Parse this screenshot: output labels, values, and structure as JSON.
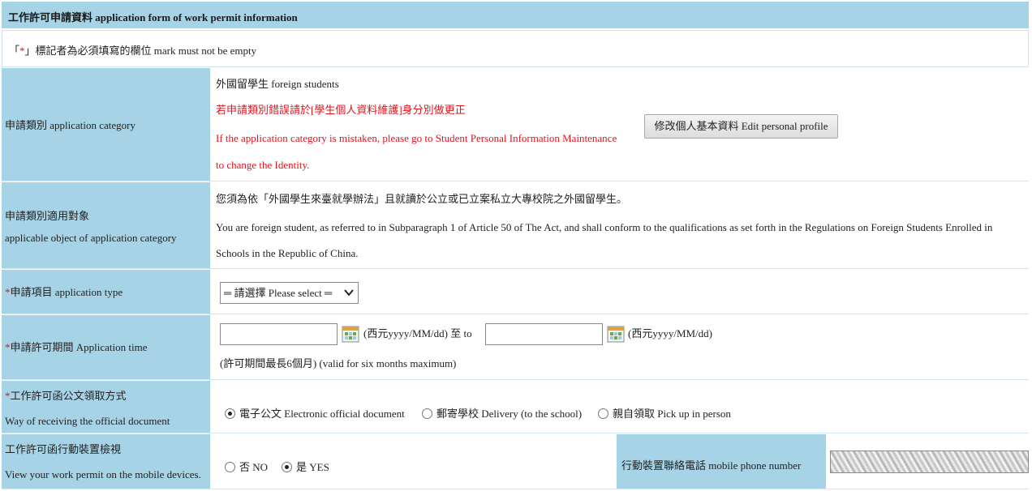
{
  "form": {
    "title": "工作許可申請資料 application form of work permit information",
    "required_note_prefix": "「",
    "required_mark": "*",
    "required_note_suffix": "」標記者為必須填寫的欄位 mark must not be empty",
    "category": {
      "label": "申請類別 application category",
      "value": "外國留學生 foreign students",
      "warning_zh": "若申請類別錯誤請於[學生個人資料維護]身分別做更正",
      "warning_en_1": "If the application category is mistaken, please go to Student Personal Information Maintenance",
      "warning_en_2": "to change the Identity.",
      "edit_button": "修改個人基本資料 Edit personal profile"
    },
    "applicable": {
      "label_zh": "申請類別適用對象",
      "label_en": "applicable object of application category",
      "text_zh": "您須為依「外國學生來臺就學辦法」且就讀於公立或已立案私立大專校院之外國留學生。",
      "text_en_1": "You are foreign student, as referred to in Subparagraph 1 of Article 50 of The Act, and shall conform to the qualifications as set forth in the Regulations on Foreign Students Enrolled in",
      "text_en_2": "Schools in the Republic of China."
    },
    "type": {
      "mark": "*",
      "label": "申請項目 application type",
      "select_value": "═ 請選擇 Please select ═"
    },
    "period": {
      "mark": "*",
      "label": "申請許可期間 Application time",
      "start_value": "",
      "end_value": "",
      "format_1": "(西元yyyy/MM/dd) 至 to",
      "format_2": "(西元yyyy/MM/dd)",
      "note": "(許可期間最長6個月) (valid for six months maximum)"
    },
    "receive": {
      "mark": "*",
      "label_zh": "工作許可函公文領取方式",
      "label_en": "Way of receiving the official document",
      "options": [
        {
          "label": "電子公文 Electronic official document",
          "selected": true
        },
        {
          "label": "郵寄學校 Delivery (to the school)",
          "selected": false
        },
        {
          "label": "親自領取 Pick up in person",
          "selected": false
        }
      ]
    },
    "mobile": {
      "label_zh": "工作許可函行動裝置檢視",
      "label_en": "View your work permit on the mobile devices.",
      "options": [
        {
          "label": "否 NO",
          "selected": false
        },
        {
          "label": "是 YES",
          "selected": true
        }
      ],
      "phone_label": "行動裝置聯絡電話 mobile phone number"
    }
  }
}
